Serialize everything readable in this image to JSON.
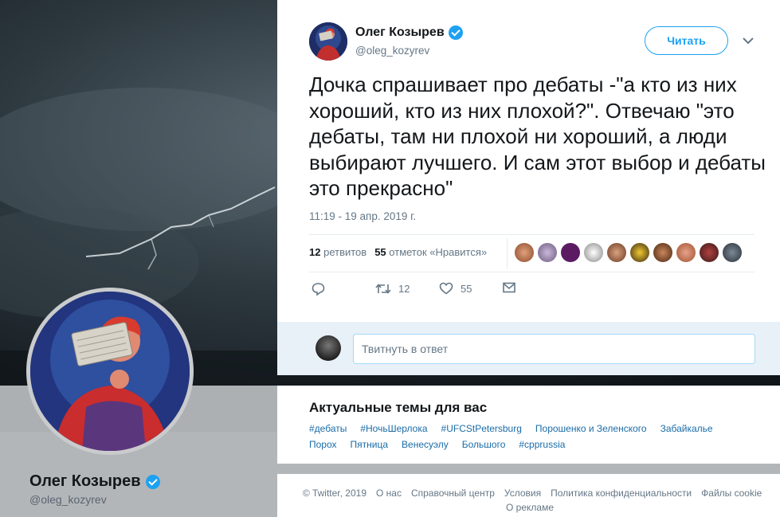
{
  "profile": {
    "name": "Олег Козырев",
    "handle": "@oleg_kozyrev"
  },
  "tweet": {
    "author_name": "Олег Козырев",
    "author_handle": "@oleg_kozyrev",
    "follow_label": "Читать",
    "text": "Дочка спрашивает про дебаты -\"а кто из них хороший, кто из них плохой?\". Отвечаю \"это дебаты, там ни плохой ни хороший, а люди выбирают лучшего. И сам этот выбор и дебаты это прекрасно\"",
    "timestamp": "11:19 - 19 апр. 2019 г.",
    "retweets_count": "12",
    "retweets_label": "ретвитов",
    "likes_count": "55",
    "likes_label": "отметок «Нравится»",
    "actions": {
      "retweet_count": "12",
      "like_count": "55"
    }
  },
  "reply": {
    "placeholder": "Твитнуть в ответ"
  },
  "trends": {
    "title": "Актуальные темы для вас",
    "row1": [
      "#дебаты",
      "#НочьШерлока",
      "#UFCStPetersburg",
      "Порошенко и Зеленского",
      "Забайкалье"
    ],
    "row2": [
      "Порох",
      "Пятница",
      "Венесуэлу",
      "Большого",
      "#cpprussia"
    ]
  },
  "footer": {
    "links": [
      "© Twitter, 2019",
      "О нас",
      "Справочный центр",
      "Условия",
      "Политика конфиденциальности",
      "Файлы cookie"
    ],
    "ads": "О рекламе"
  },
  "colors": {
    "accent": "#1da1f2",
    "link": "#1b6ca8",
    "muted": "#657786"
  }
}
